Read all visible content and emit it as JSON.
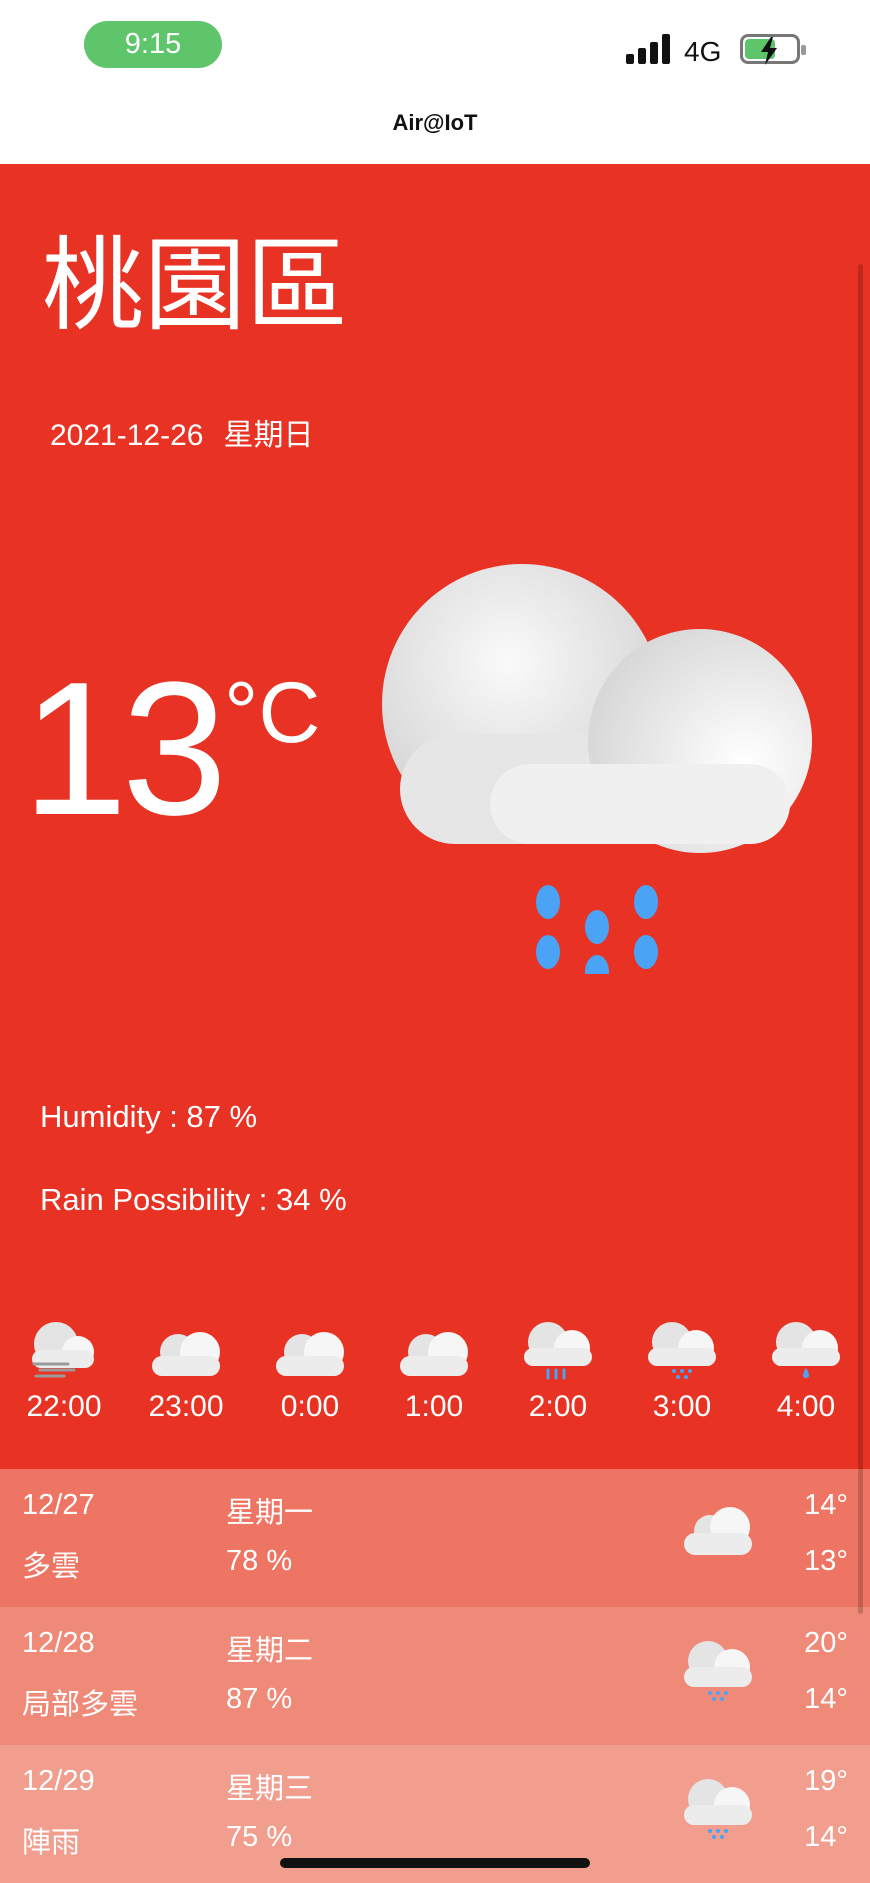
{
  "status_bar": {
    "time": "9:15",
    "network": "4G"
  },
  "app_title": "Air@IoT",
  "location": "桃園區",
  "date": "2021-12-26",
  "weekday": "星期日",
  "current": {
    "temperature": "13",
    "unit": "°C",
    "icon": "cloud-rain-icon",
    "humidity_text": "Humidity : 87 %",
    "rain_text": "Rain Possibility : 34 %"
  },
  "hourly": [
    {
      "time": "22:00",
      "icon": "cloud-wind-icon"
    },
    {
      "time": "23:00",
      "icon": "cloud-icon"
    },
    {
      "time": "0:00",
      "icon": "cloud-icon"
    },
    {
      "time": "1:00",
      "icon": "cloud-icon"
    },
    {
      "time": "2:00",
      "icon": "cloud-rain-icon"
    },
    {
      "time": "3:00",
      "icon": "cloud-drizzle-icon"
    },
    {
      "time": "4:00",
      "icon": "cloud-drop-icon"
    }
  ],
  "daily": [
    {
      "date": "12/27",
      "desc": "多雲",
      "weekday": "星期一",
      "humidity": "78 %",
      "high": "14°",
      "low": "13°",
      "icon": "cloud-icon",
      "bg": "#ee7563"
    },
    {
      "date": "12/28",
      "desc": "局部多雲",
      "weekday": "星期二",
      "humidity": "87 %",
      "high": "20°",
      "low": "14°",
      "icon": "cloud-drizzle-icon",
      "bg": "#f08a78"
    },
    {
      "date": "12/29",
      "desc": "陣雨",
      "weekday": "星期三",
      "humidity": "75 %",
      "high": "19°",
      "low": "14°",
      "icon": "cloud-drizzle-icon",
      "bg": "#f29e8e"
    }
  ],
  "colors": {
    "hero": "#e83224",
    "rain_drop": "#4aa3f5"
  }
}
